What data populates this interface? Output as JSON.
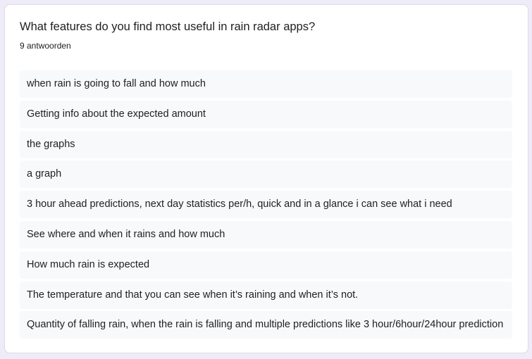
{
  "question": {
    "title": "What features do you find most useful in rain radar apps?",
    "response_count": "9 antwoorden"
  },
  "answers": [
    "when rain is going to fall and how much",
    "Getting info about the expected amount",
    "the graphs",
    "a graph",
    "3 hour ahead predictions, next day statistics per/h, quick and in a glance i can see what i need",
    "See where and when it rains and how much",
    "How much rain is expected",
    "The temperature and that you can see when it’s raining and when it’s not.",
    "Quantity of falling rain, when the rain is falling and multiple predictions like 3 hour/6hour/24hour prediction"
  ],
  "colors": {
    "page_background": "#f0ebf8",
    "card_background": "#ffffff",
    "answer_background": "#f8f9fa",
    "text": "#202124"
  }
}
